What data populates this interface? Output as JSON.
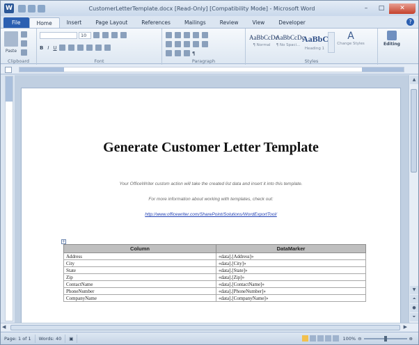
{
  "window": {
    "title": "CustomerLetterTemplate.docx [Read-Only] [Compatibility Mode] - Microsoft Word"
  },
  "ribbon": {
    "tabs": [
      "File",
      "Home",
      "Insert",
      "Page Layout",
      "References",
      "Mailings",
      "Review",
      "View",
      "Developer"
    ],
    "active_tab": "Home",
    "groups": {
      "clipboard": "Clipboard",
      "font": "Font",
      "paragraph": "Paragraph",
      "styles": "Styles",
      "editing": "Editing"
    },
    "paste_label": "Paste",
    "font_size": "10",
    "styles": [
      {
        "sample": "AaBbCcDc",
        "name": "¶ Normal"
      },
      {
        "sample": "AaBbCcDc",
        "name": "¶ No Spaci..."
      },
      {
        "sample": "AaBbC",
        "name": "Heading 1"
      }
    ],
    "change_styles": "Change Styles",
    "editing_label": "Editing"
  },
  "document": {
    "title": "Generate Customer Letter Template",
    "line1": "Your OfficeWriter custom action will take the created list data and insert it into this template.",
    "line2": "For more information about working with templates, check out:",
    "link": "http://www.officewriter.com/SharePoint/Solutions/WordExportTool/",
    "table": {
      "headers": [
        "Column",
        "DataMarker"
      ],
      "rows": [
        [
          "Address",
          "«data].[Address]»"
        ],
        [
          "City",
          "«data].[City]»"
        ],
        [
          "State",
          "«data].[State]»"
        ],
        [
          "Zip",
          "«data].[Zip]»"
        ],
        [
          "ContactName",
          "«data].[ContactName]»"
        ],
        [
          "PhoneNumber",
          "«data].[PhoneNumber]»"
        ],
        [
          "CompanyName",
          "«data].[CompanyName]»"
        ]
      ]
    }
  },
  "status": {
    "page": "Page: 1 of 1",
    "words": "Words: 40",
    "zoom": "100%",
    "zoom_fraction": 0.5
  }
}
